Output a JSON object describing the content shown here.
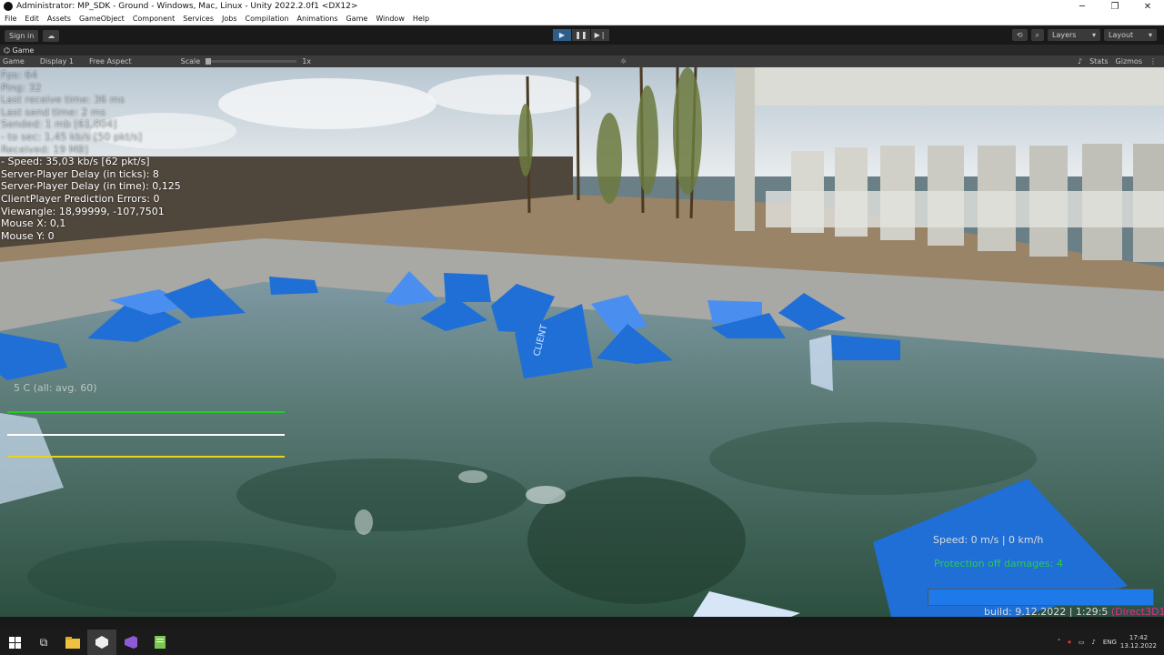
{
  "window": {
    "title": "Administrator: MP_SDK - Ground - Windows, Mac, Linux - Unity 2022.2.0f1 <DX12>",
    "minimize": "─",
    "maximize": "❐",
    "close": "✕"
  },
  "menu": [
    "File",
    "Edit",
    "Assets",
    "GameObject",
    "Component",
    "Services",
    "Jobs",
    "Compilation",
    "Animations",
    "Game",
    "Window",
    "Help"
  ],
  "toolbar": {
    "sign_in": "Sign in",
    "layers": "Layers",
    "layout": "Layout"
  },
  "game_view": {
    "tab": "Game",
    "mode": "Game",
    "display": "Display 1",
    "aspect": "Free Aspect",
    "scale_label": "Scale",
    "scale_value": "1x",
    "stats": "Stats",
    "gizmos": "Gizmos"
  },
  "hud": {
    "faded_lines": [
      "Fps: 64",
      "Ping: 32",
      "Last receive time: 36 ms",
      "Last send time: 2 ms",
      "Sended: 1 mb [61,004]",
      " - to sec: 1,45 kb/s [50 pkt/s]"
    ],
    "received": "Received:   19 MB]",
    "lines": [
      " - Speed: 35,03 kb/s [62 pkt/s]",
      "Server-Player Delay (in ticks): 8",
      "Server-Player Delay (in time): 0,125",
      "ClientPlayer Prediction Errors: 0",
      "Viewangle: 18,99999, -107,7501",
      "Mouse X: 0,1",
      "Mouse Y: 0"
    ],
    "fps_graph_label": "5 C (all: avg. 60)",
    "speed": "Speed: 0 m/s  | 0 km/h",
    "protection": "Protection off damages: 4",
    "health_fraction": 1.0,
    "build": "build: 9.12.2022 | 1:29:5 ",
    "build_api": "(Direct3D12)"
  },
  "cube_label": "CLIENT",
  "colors": {
    "cube_blue": "#1f6fd6",
    "graph_green": "#22cc22",
    "graph_white": "#ffffff",
    "graph_yellow": "#e8d21c",
    "bar_blue": "#1e7ae8"
  },
  "taskbar": {
    "tray_lang": "ENG",
    "time": "17:42",
    "date": "13.12.2022"
  }
}
